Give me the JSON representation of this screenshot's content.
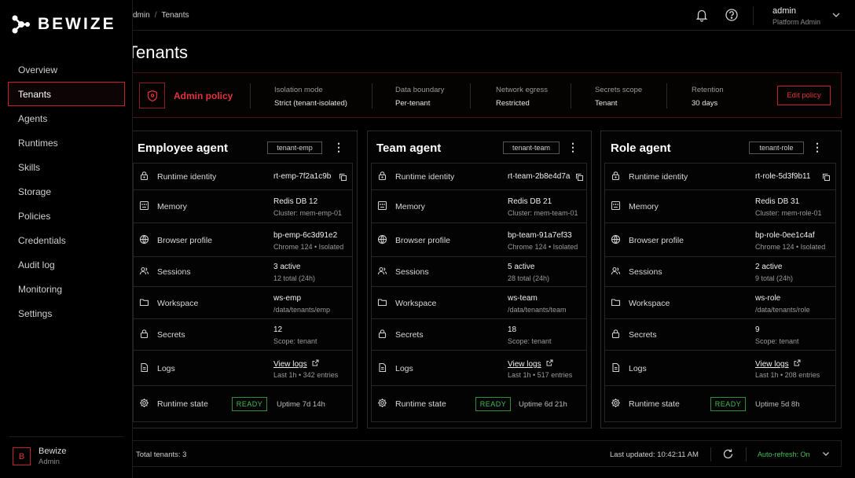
{
  "brand": {
    "name": "BEWIZE"
  },
  "sidebar": {
    "items": [
      {
        "label": "Overview"
      },
      {
        "label": "Tenants",
        "active": true
      },
      {
        "label": "Agents"
      },
      {
        "label": "Runtimes"
      },
      {
        "label": "Skills"
      },
      {
        "label": "Storage"
      },
      {
        "label": "Policies"
      },
      {
        "label": "Credentials"
      },
      {
        "label": "Audit log"
      },
      {
        "label": "Monitoring"
      },
      {
        "label": "Settings"
      }
    ],
    "user": {
      "initial": "B",
      "name": "Bewize",
      "role": "Admin"
    }
  },
  "topbar": {
    "breadcrumb": [
      "dmin",
      "Tenants"
    ],
    "breadcrumb_sep": "/",
    "user": {
      "name": "admin",
      "role": "Platform Admin"
    },
    "icons": [
      "bell-icon",
      "help-icon",
      "chevron-down-icon"
    ]
  },
  "page": {
    "title": "Tenants"
  },
  "policy": {
    "label": "Admin policy",
    "fields": [
      {
        "key": "Isolation mode",
        "value": "Strict (tenant-isolated)"
      },
      {
        "key": "Data boundary",
        "value": "Per-tenant"
      },
      {
        "key": "Network egress",
        "value": "Restricted"
      },
      {
        "key": "Secrets scope",
        "value": "Tenant"
      },
      {
        "key": "Retention",
        "value": "30 days"
      }
    ],
    "edit_label": "Edit policy"
  },
  "row_labels": {
    "runtime": "Runtime identity",
    "memory": "Memory",
    "browser": "Browser profile",
    "sessions": "Sessions",
    "workspace": "Workspace",
    "secrets": "Secrets",
    "logs": "Logs",
    "state": "Runtime state"
  },
  "cards": [
    {
      "title": "Employee agent",
      "tag": "tenant-emp",
      "runtime_id": "rt-emp-7f2a1c9b",
      "memory": "Redis DB 12",
      "memory_sub": "Cluster: mem-emp-01",
      "browser": "bp-emp-6c3d91e2",
      "browser_sub": "Chrome 124 • Isolated",
      "sessions": "3 active",
      "sessions_sub": "12 total (24h)",
      "workspace": "ws-emp",
      "workspace_sub": "/data/tenants/emp",
      "secrets": "12",
      "secrets_sub": "Scope: tenant",
      "logs": "View logs",
      "logs_sub": "Last 1h • 342 entries",
      "state": "READY",
      "uptime": "Uptime 7d 14h"
    },
    {
      "title": "Team agent",
      "tag": "tenant-team",
      "runtime_id": "rt-team-2b8e4d7a",
      "memory": "Redis DB 21",
      "memory_sub": "Cluster: mem-team-01",
      "browser": "bp-team-91a7ef33",
      "browser_sub": "Chrome 124 • Isolated",
      "sessions": "5 active",
      "sessions_sub": "28 total (24h)",
      "workspace": "ws-team",
      "workspace_sub": "/data/tenants/team",
      "secrets": "18",
      "secrets_sub": "Scope: tenant",
      "logs": "View logs",
      "logs_sub": "Last 1h • 517 entries",
      "state": "READY",
      "uptime": "Uptime 6d 21h"
    },
    {
      "title": "Role agent",
      "tag": "tenant-role",
      "runtime_id": "rt-role-5d3f9b11",
      "memory": "Redis DB 31",
      "memory_sub": "Cluster: mem-role-01",
      "browser": "bp-role-0ee1c4af",
      "browser_sub": "Chrome 124 • Isolated",
      "sessions": "2 active",
      "sessions_sub": "9 total (24h)",
      "workspace": "ws-role",
      "workspace_sub": "/data/tenants/role",
      "secrets": "9",
      "secrets_sub": "Scope: tenant",
      "logs": "View logs",
      "logs_sub": "Last 1h • 208 entries",
      "state": "READY",
      "uptime": "Uptime 5d 8h"
    }
  ],
  "footer": {
    "total": "Total tenants: 3",
    "updated": "Last updated: 10:42:11 AM",
    "auto_label": "Auto-refresh:",
    "auto_value": "On"
  },
  "colors": {
    "accent": "#c8202a",
    "ready": "#3fbf56",
    "background": "#000000"
  }
}
